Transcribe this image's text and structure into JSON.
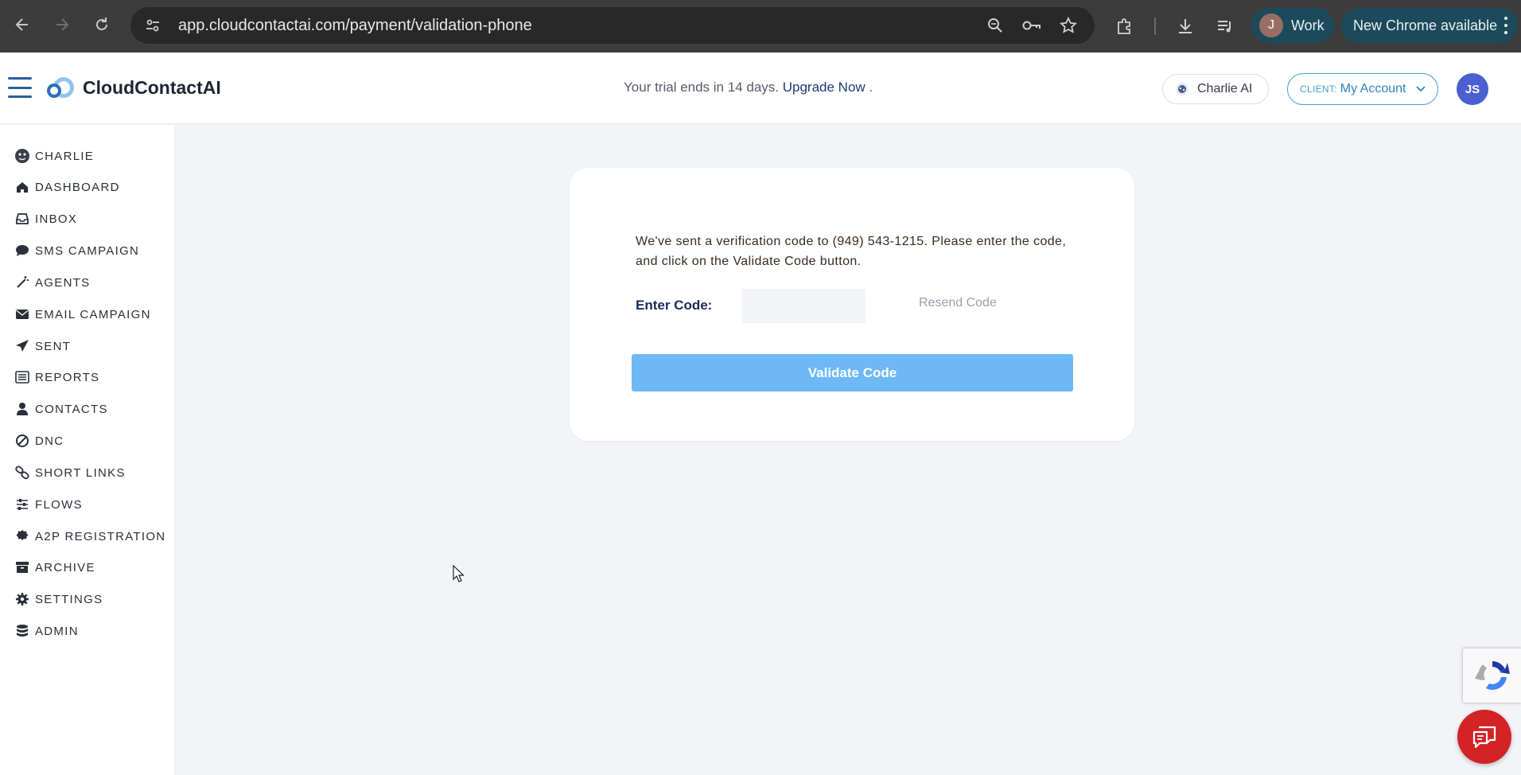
{
  "browser": {
    "url": "app.cloudcontactai.com/payment/validation-phone",
    "profile_initial": "J",
    "profile_label": "Work",
    "update_label": "New Chrome available"
  },
  "header": {
    "brand": "CloudContactAI",
    "trial_text": "Your trial ends in 14 days.",
    "upgrade_link": "Upgrade Now",
    "trial_suffix": ".",
    "charlie_label": "Charlie AI",
    "client_prefix": "CLIENT:",
    "client_value": "My Account",
    "user_initials": "JS"
  },
  "sidebar": {
    "items": [
      {
        "label": "CHARLIE",
        "icon": "charlie-icon"
      },
      {
        "label": "DASHBOARD",
        "icon": "home-icon"
      },
      {
        "label": "INBOX",
        "icon": "inbox-icon"
      },
      {
        "label": "SMS CAMPAIGN",
        "icon": "chat-bubble-icon"
      },
      {
        "label": "AGENTS",
        "icon": "magic-wand-icon"
      },
      {
        "label": "EMAIL CAMPAIGN",
        "icon": "envelope-icon"
      },
      {
        "label": "SENT",
        "icon": "paper-plane-icon"
      },
      {
        "label": "REPORTS",
        "icon": "list-icon"
      },
      {
        "label": "CONTACTS",
        "icon": "user-icon"
      },
      {
        "label": "DNC",
        "icon": "ban-icon"
      },
      {
        "label": "SHORT LINKS",
        "icon": "link-icon"
      },
      {
        "label": "FLOWS",
        "icon": "sliders-icon"
      },
      {
        "label": "A2P REGISTRATION",
        "icon": "certificate-icon"
      },
      {
        "label": "ARCHIVE",
        "icon": "archive-box-icon"
      },
      {
        "label": "SETTINGS",
        "icon": "gear-icon"
      },
      {
        "label": "ADMIN",
        "icon": "database-icon"
      }
    ]
  },
  "verification": {
    "message": "We've sent a verification code to (949) 543-1215. Please enter the code, and click on the Validate Code button.",
    "enter_label": "Enter Code:",
    "code_value": "",
    "resend_label": "Resend Code",
    "validate_label": "Validate Code"
  },
  "colors": {
    "accent": "#6db8f5",
    "chat_bubble": "#d32325",
    "brand_blue": "#2a5f9e"
  }
}
